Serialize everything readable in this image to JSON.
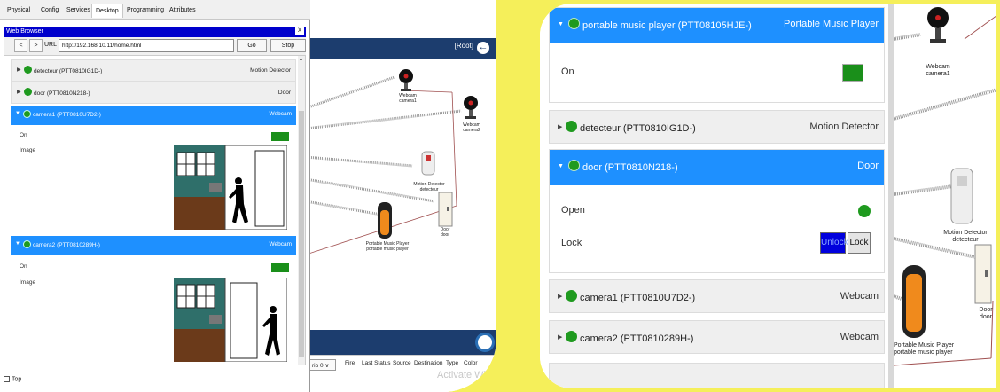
{
  "left": {
    "tabs": [
      "Physical",
      "Config",
      "Services",
      "Desktop",
      "Programming",
      "Attributes"
    ],
    "active_tab": "Desktop",
    "browser": {
      "title": "Web Browser",
      "close": "X",
      "back": "<",
      "forward": ">",
      "url_label": "URL",
      "url": "http://192.168.10.11/home.html",
      "go": "Go",
      "stop": "Stop"
    },
    "rows": [
      {
        "name": "detecteur (PTT0810IG1D-)",
        "type": "Motion Detector"
      },
      {
        "name": "door (PTT0810N218-)",
        "type": "Door"
      }
    ],
    "cameras": [
      {
        "name": "camera1 (PTT0810U7D2-)",
        "type": "Webcam",
        "on_label": "On",
        "image_label": "Image"
      },
      {
        "name": "camera2 (PTT0810289H-)",
        "type": "Webcam",
        "on_label": "On",
        "image_label": "Image"
      }
    ],
    "top_checkbox": "Top",
    "workspace": {
      "root_label": "[Root]",
      "labels": {
        "webcam1": "Webcam\ncamera1",
        "webcam2": "Webcam\ncamera2",
        "motion": "Motion Detector\ndetecteur",
        "music": "Portable Music Player\nportable music player",
        "door": "Door\ndoor"
      },
      "scenario": "rio 0",
      "columns": [
        "Fire",
        "Last Status",
        "Source",
        "Destination",
        "Type",
        "Color"
      ],
      "watermark": "Activate Wi"
    }
  },
  "right": {
    "music": {
      "name": "portable music player (PTT08105HJE-)",
      "type": "Portable Music Player",
      "on_label": "On"
    },
    "detector": {
      "name": "detecteur (PTT0810IG1D-)",
      "type": "Motion Detector"
    },
    "door": {
      "name": "door (PTT0810N218-)",
      "type": "Door",
      "open_label": "Open",
      "lock_label": "Lock",
      "unlock_btn": "Unlock",
      "lock_btn": "Lock"
    },
    "camera1": {
      "name": "camera1 (PTT0810U7D2-)",
      "type": "Webcam"
    },
    "camera2": {
      "name": "camera2 (PTT0810289H-)",
      "type": "Webcam"
    },
    "canvas_labels": {
      "webcam": "Webcam\ncamera1",
      "motion": "Motion Detector\ndetecteur",
      "door": "Door\ndoor",
      "music": "Portable Music Player\nportable music player"
    }
  },
  "colors": {
    "accent_blue": "#1e90ff",
    "status_green": "#1f9a1f",
    "frame_yellow": "#f5ef5a",
    "title_blue": "#0000cc"
  }
}
